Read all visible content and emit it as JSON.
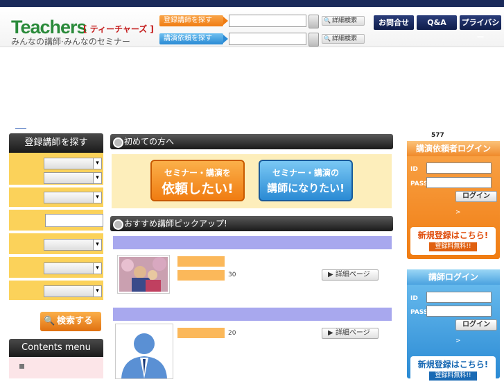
{
  "header": {
    "logo": "Teachers",
    "logo_kana": "[ ティーチャーズ ]",
    "tagline": "みんなの講師·みんなのセミナー",
    "search_rows": [
      {
        "label": "登録講師を探す",
        "detail": "詳細検索"
      },
      {
        "label": "講演依頼を探す",
        "detail": "詳細検索"
      }
    ],
    "nav": [
      "お問合せ",
      "Q&A",
      "プライバシー"
    ]
  },
  "left": {
    "title": "登録講師を探す",
    "search_button": "検索する",
    "contents_title": "Contents menu"
  },
  "main": {
    "intro_title": "初めての方へ",
    "intro_buttons": [
      {
        "line1": "セミナー・講演を",
        "line2": "依頼したい!",
        "color": "#f07c12"
      },
      {
        "line1": "セミナー・講演の",
        "line2": "講師になりたい!",
        "color": "#2a8ad4"
      }
    ],
    "pickup_title": "おすすめ講師ピックアップ!",
    "pickups": [
      {
        "age": "30",
        "detail": "▶ 詳細ページ"
      },
      {
        "age": "20",
        "detail": "▶ 詳細ページ"
      }
    ]
  },
  "right": {
    "count": "577",
    "client_login": {
      "title": "講演依頼者ログイン",
      "id_label": "ID",
      "pass_label": "PASS",
      "login": "ログイン",
      "arrow": ">",
      "register": "新規登録はこちら!",
      "free": "登録料無料!!"
    },
    "teacher_login": {
      "title": "講師ログイン",
      "id_label": "ID",
      "pass_label": "PASS",
      "login": "ログイン",
      "arrow": ">",
      "register": "新規登録はこちら!",
      "free": "登録料無料!!"
    }
  }
}
